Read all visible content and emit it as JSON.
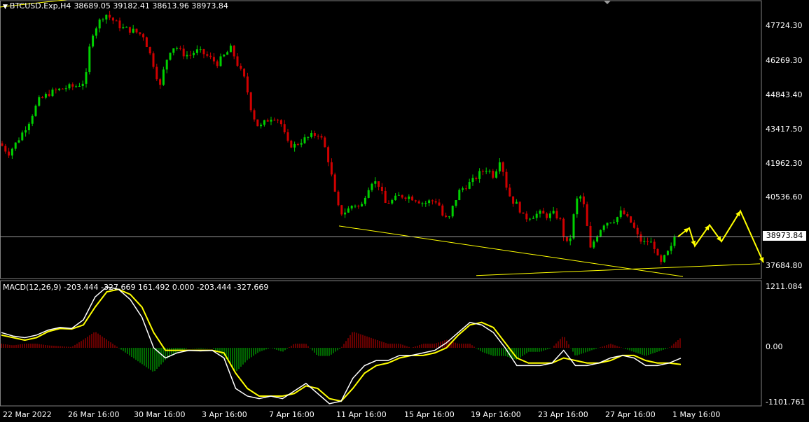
{
  "header": {
    "symbol": "BTCUSD.Exp,H4",
    "ohlc": "38689.05 39182.41 38613.96 38973.84"
  },
  "price_axis": {
    "ticks": [
      "47724.30",
      "46269.30",
      "44843.40",
      "43417.50",
      "41962.30",
      "40536.60",
      "37684.80"
    ],
    "current_price": "38973.84",
    "current_price_value": 38973.84
  },
  "macd": {
    "label": "MACD(12,26,9) -203.444 -327.669 161.492 0.000 -203.444 -327.669",
    "ticks": [
      "1211.084",
      "0.00",
      "-1101.761"
    ]
  },
  "time_axis": {
    "labels": [
      "22 Mar 2022",
      "26 Mar 16:00",
      "30 Mar 16:00",
      "3 Apr 16:00",
      "7 Apr 16:00",
      "11 Apr 16:00",
      "15 Apr 16:00",
      "19 Apr 16:00",
      "23 Apr 16:00",
      "27 Apr 16:00",
      "1 May 16:00"
    ]
  },
  "colors": {
    "background": "#000000",
    "bull": "#00d000",
    "bear": "#d00000",
    "trendline": "#ffff00",
    "macd_line": "#ffffff",
    "signal_line": "#ffff00",
    "grid": "#808080"
  },
  "chart_data": {
    "type": "candlestick",
    "title": "BTCUSD.Exp,H4",
    "ylim": [
      37300,
      48400
    ],
    "price_path": [
      [
        0,
        42700
      ],
      [
        12,
        42300
      ],
      [
        25,
        42800
      ],
      [
        40,
        43500
      ],
      [
        55,
        44400
      ],
      [
        70,
        44700
      ],
      [
        90,
        44900
      ],
      [
        110,
        45000
      ],
      [
        122,
        45200
      ],
      [
        130,
        47000
      ],
      [
        140,
        47500
      ],
      [
        150,
        47900
      ],
      [
        162,
        47600
      ],
      [
        175,
        47300
      ],
      [
        190,
        47200
      ],
      [
        205,
        47000
      ],
      [
        215,
        46200
      ],
      [
        222,
        45600
      ],
      [
        228,
        44900
      ],
      [
        235,
        45800
      ],
      [
        242,
        46400
      ],
      [
        250,
        46600
      ],
      [
        260,
        46300
      ],
      [
        270,
        46200
      ],
      [
        280,
        46400
      ],
      [
        290,
        46300
      ],
      [
        300,
        46100
      ],
      [
        310,
        45900
      ],
      [
        320,
        46200
      ],
      [
        330,
        46500
      ],
      [
        340,
        45800
      ],
      [
        350,
        45200
      ],
      [
        360,
        43900
      ],
      [
        370,
        43300
      ],
      [
        380,
        43600
      ],
      [
        390,
        43800
      ],
      [
        400,
        43600
      ],
      [
        410,
        42700
      ],
      [
        420,
        42600
      ],
      [
        430,
        42800
      ],
      [
        445,
        43000
      ],
      [
        455,
        43100
      ],
      [
        462,
        42700
      ],
      [
        470,
        41900
      ],
      [
        478,
        40700
      ],
      [
        485,
        39900
      ],
      [
        495,
        40000
      ],
      [
        505,
        40300
      ],
      [
        515,
        40100
      ],
      [
        522,
        40700
      ],
      [
        530,
        41200
      ],
      [
        540,
        41100
      ],
      [
        550,
        40300
      ],
      [
        560,
        40400
      ],
      [
        570,
        40600
      ],
      [
        580,
        40600
      ],
      [
        592,
        40500
      ],
      [
        605,
        40300
      ],
      [
        615,
        40400
      ],
      [
        625,
        40400
      ],
      [
        632,
        39800
      ],
      [
        640,
        39600
      ],
      [
        648,
        40300
      ],
      [
        656,
        40800
      ],
      [
        665,
        41000
      ],
      [
        675,
        41200
      ],
      [
        685,
        41500
      ],
      [
        695,
        41700
      ],
      [
        705,
        41400
      ],
      [
        715,
        42200
      ],
      [
        720,
        41300
      ],
      [
        726,
        40700
      ],
      [
        732,
        40400
      ],
      [
        740,
        40200
      ],
      [
        748,
        39700
      ],
      [
        758,
        39800
      ],
      [
        770,
        39900
      ],
      [
        782,
        39800
      ],
      [
        792,
        39900
      ],
      [
        800,
        39600
      ],
      [
        808,
        38600
      ],
      [
        815,
        39000
      ],
      [
        822,
        40400
      ],
      [
        830,
        40600
      ],
      [
        836,
        39900
      ],
      [
        842,
        38400
      ],
      [
        848,
        38800
      ],
      [
        855,
        39200
      ],
      [
        862,
        39500
      ],
      [
        870,
        39600
      ],
      [
        880,
        39700
      ],
      [
        888,
        40000
      ],
      [
        895,
        39700
      ],
      [
        902,
        39500
      ],
      [
        910,
        39000
      ],
      [
        918,
        38700
      ],
      [
        926,
        38800
      ],
      [
        934,
        38600
      ],
      [
        942,
        37800
      ],
      [
        950,
        38200
      ],
      [
        958,
        38500
      ],
      [
        965,
        38973.84
      ]
    ],
    "trendlines": [
      {
        "x": [
          0,
          165
        ],
        "y": [
          48150,
          48650
        ]
      },
      {
        "x": [
          484,
          975
        ],
        "y": [
          39400,
          37380
        ]
      },
      {
        "x": [
          680,
          1085
        ],
        "y": [
          37420,
          37890
        ]
      },
      {
        "x": [
          0,
          1085
        ],
        "y": [
          38973.84,
          38973.84
        ]
      }
    ],
    "projection": [
      [
        968,
        38973.84
      ],
      [
        984,
        39320
      ],
      [
        992,
        38600
      ],
      [
        1013,
        39440
      ],
      [
        1030,
        38780
      ],
      [
        1057,
        40000
      ],
      [
        1090,
        37940
      ]
    ],
    "macd_series": [
      {
        "name": "MACD",
        "values": [
          300,
          230,
          200,
          250,
          350,
          400,
          380,
          550,
          1000,
          1200,
          1150,
          950,
          600,
          0,
          -200,
          -100,
          -50,
          -60,
          -50,
          -200,
          -800,
          -950,
          -1000,
          -950,
          -1000,
          -850,
          -700,
          -900,
          -1100,
          -1050,
          -600,
          -350,
          -250,
          -250,
          -150,
          -150,
          -100,
          -50,
          100,
          300,
          500,
          450,
          300,
          0,
          -350,
          -350,
          -350,
          -300,
          -50,
          -350,
          -350,
          -300,
          -200,
          -150,
          -200,
          -350,
          -350,
          -300,
          -204
        ]
      },
      {
        "name": "Signal",
        "values": [
          250,
          200,
          150,
          200,
          320,
          380,
          370,
          450,
          800,
          1100,
          1150,
          1050,
          800,
          300,
          -50,
          -50,
          -50,
          -50,
          -50,
          -100,
          -500,
          -800,
          -950,
          -950,
          -950,
          -900,
          -750,
          -800,
          -1000,
          -1050,
          -800,
          -500,
          -350,
          -300,
          -200,
          -150,
          -150,
          -100,
          0,
          250,
          450,
          500,
          400,
          100,
          -200,
          -300,
          -300,
          -300,
          -200,
          -250,
          -300,
          -300,
          -250,
          -150,
          -150,
          -250,
          -300,
          -300,
          -328
        ]
      }
    ],
    "macd_ylim": [
      -1101.761,
      1211.084
    ],
    "grid": false
  }
}
